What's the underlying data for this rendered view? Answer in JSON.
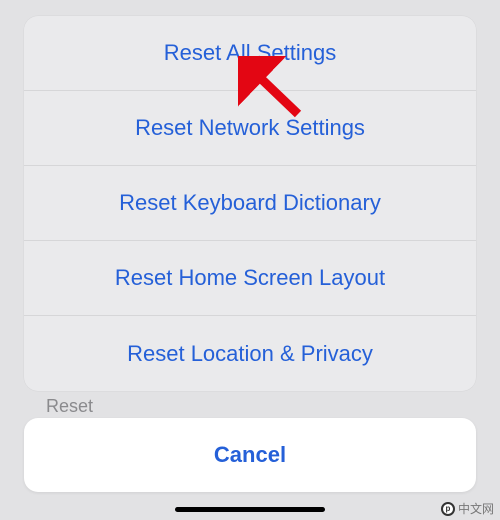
{
  "sheet": {
    "items": [
      {
        "label": "Reset All Settings"
      },
      {
        "label": "Reset Network Settings"
      },
      {
        "label": "Reset Keyboard Dictionary"
      },
      {
        "label": "Reset Home Screen Layout"
      },
      {
        "label": "Reset Location & Privacy"
      }
    ]
  },
  "cancel": {
    "label": "Cancel"
  },
  "background": {
    "menu_label": "Reset"
  },
  "watermark": {
    "text": "中文网"
  },
  "annotation": {
    "arrow_color": "#e30613"
  }
}
